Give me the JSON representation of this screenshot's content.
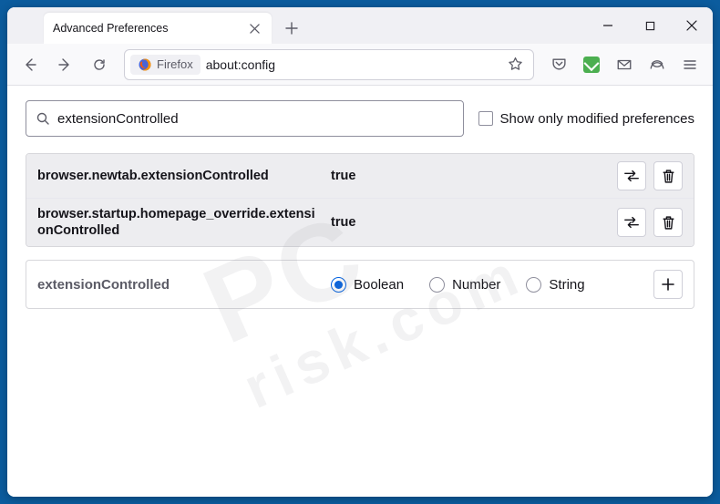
{
  "tab": {
    "title": "Advanced Preferences"
  },
  "urlbar": {
    "identity": "Firefox",
    "url": "about:config"
  },
  "search": {
    "value": "extensionControlled",
    "show_modified_label": "Show only modified preferences",
    "show_modified_checked": false
  },
  "prefs": [
    {
      "name": "browser.newtab.extensionControlled",
      "value": "true",
      "modified": true
    },
    {
      "name": "browser.startup.homepage_override.extensionControlled",
      "value": "true",
      "modified": true
    }
  ],
  "new_pref": {
    "name": "extensionControlled",
    "types": [
      "Boolean",
      "Number",
      "String"
    ],
    "selected": "Boolean"
  },
  "watermark": {
    "line1": "PC",
    "line2": "risk.com"
  }
}
